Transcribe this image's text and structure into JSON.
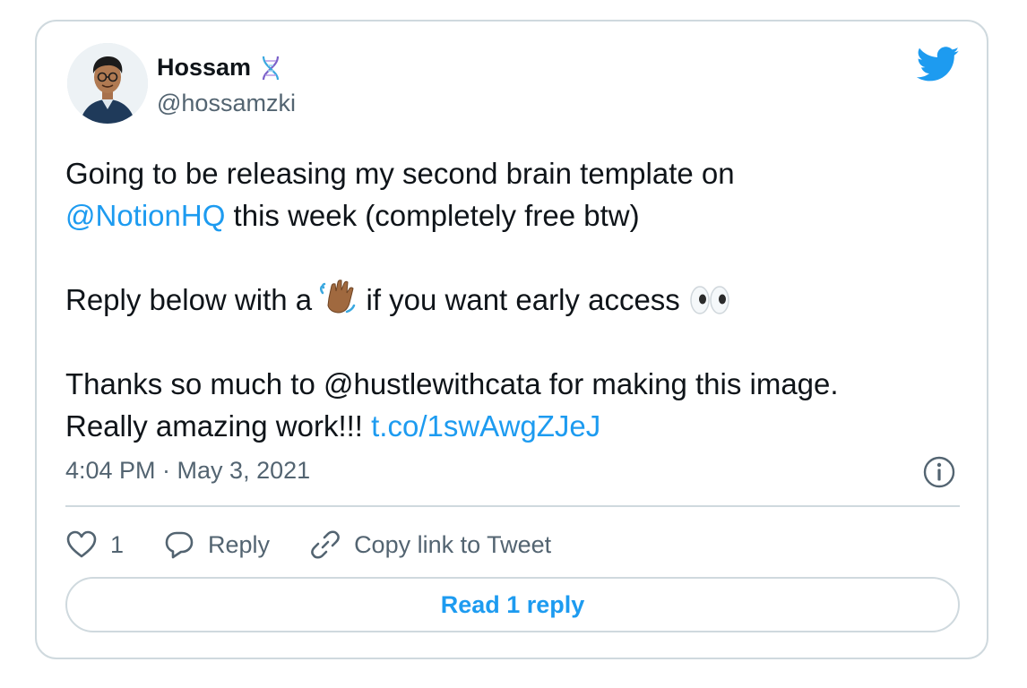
{
  "tweet": {
    "author": {
      "name": "Hossam",
      "name_emoji": "dna-emoji",
      "handle": "@hossamzki"
    },
    "body": {
      "line1": "Going to be releasing my second brain template on",
      "mention": "@NotionHQ",
      "line2_rest": " this week (completely free btw)",
      "line3_pre": "Reply below with a ",
      "line3_emoji": "waving-hand-emoji",
      "line3_mid": " if you want early access ",
      "line3_end_emoji": "eyes-emoji",
      "line4": "Thanks so much to @hustlewithcata for making this image.",
      "line5_pre": "Really amazing work!!! ",
      "link": "t.co/1swAwgZJeJ"
    },
    "timestamp": "4:04 PM · May 3, 2021",
    "actions": {
      "like_count": "1",
      "reply_label": "Reply",
      "copy_label": "Copy link to Tweet"
    },
    "read_replies_label": "Read 1 reply",
    "colors": {
      "accent": "#1d9bf0",
      "text": "#0f1419",
      "secondary": "#536471",
      "border": "#cfd9de"
    },
    "icons": [
      "twitter-bird-icon",
      "info-icon",
      "heart-icon",
      "reply-bubble-icon",
      "link-icon"
    ]
  }
}
